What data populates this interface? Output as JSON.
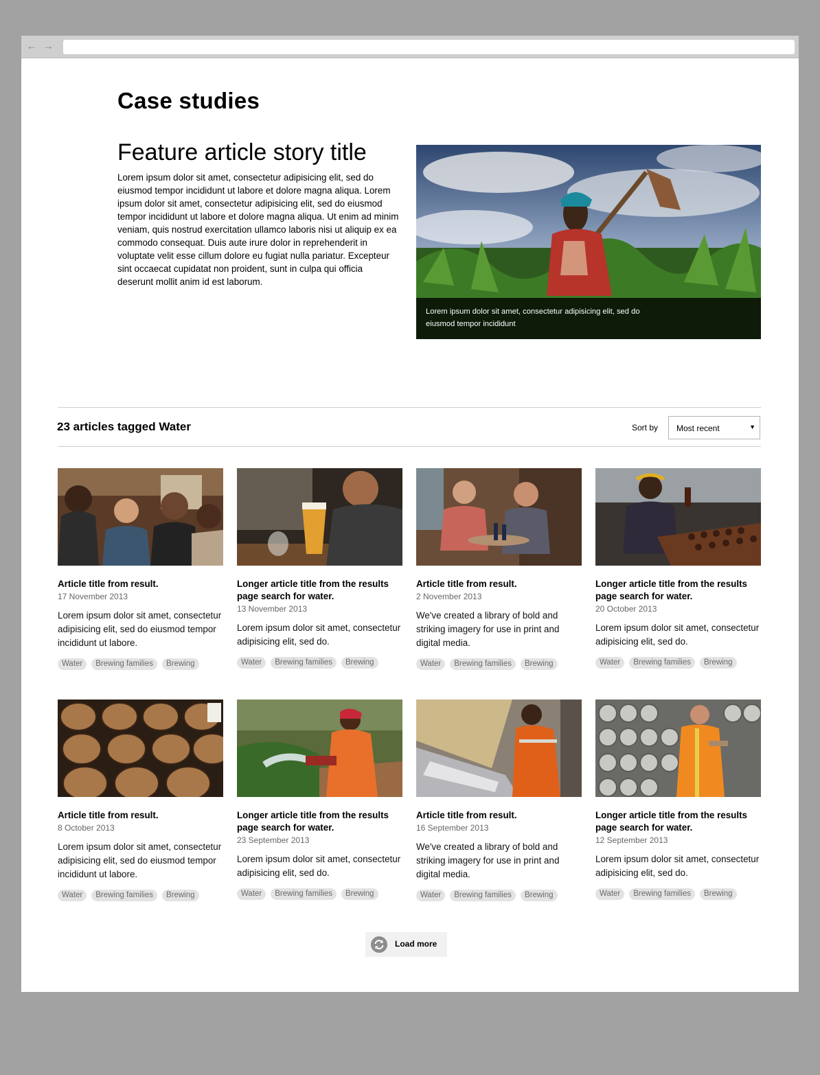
{
  "browser": {
    "back_icon": "arrow-left-icon",
    "forward_icon": "arrow-right-icon",
    "address": ""
  },
  "page": {
    "title": "Case studies"
  },
  "feature": {
    "title": "Feature article story title",
    "body": "Lorem ipsum dolor sit amet, consectetur adipisicing elit, sed do eiusmod tempor incididunt ut labore et dolore magna aliqua. Lorem ipsum dolor sit amet, consectetur adipisicing elit, sed do eiusmod tempor incididunt ut labore et dolore magna aliqua. Ut enim ad minim veniam, quis nostrud exercitation ullamco laboris nisi ut aliquip ex ea commodo consequat. Duis aute irure dolor in reprehenderit in voluptate velit esse cillum dolore eu fugiat nulla pariatur. Excepteur sint occaecat cupidatat non proident, sunt in culpa qui officia deserunt mollit anim id est laborum.",
    "image_caption": "Lorem ipsum dolor sit amet, consectetur adipisicing elit, sed do eiusmod tempor incididunt"
  },
  "results": {
    "title": "23 articles tagged Water",
    "sort_label": "Sort by",
    "sort_value": "Most recent",
    "articles": [
      {
        "title": "Article title from result.",
        "date": "17 November 2013",
        "text": "Lorem ipsum dolor sit amet, consectetur adipisicing elit, sed do eiusmod tempor incididunt ut labore.",
        "tags": [
          "Water",
          "Brewing families",
          "Brewing"
        ]
      },
      {
        "title": "Longer article title from the results page search for water.",
        "date": "13 November 2013",
        "text": "Lorem ipsum dolor sit amet, consectetur adipisicing elit, sed do.",
        "tags": [
          "Water",
          "Brewing families",
          "Brewing"
        ]
      },
      {
        "title": "Article title from result.",
        "date": "2 November 2013",
        "text": "We've created a library of bold and striking imagery for use in print and digital media.",
        "tags": [
          "Water",
          "Brewing families",
          "Brewing"
        ]
      },
      {
        "title": "Longer article title from the results page search for water.",
        "date": "20 October 2013",
        "text": "Lorem ipsum dolor sit amet, consectetur adipisicing elit, sed do.",
        "tags": [
          "Water",
          "Brewing families",
          "Brewing"
        ]
      },
      {
        "title": "Article title from result.",
        "date": "8 October 2013",
        "text": "Lorem ipsum dolor sit amet, consectetur adipisicing elit, sed do eiusmod tempor incididunt ut labore.",
        "tags": [
          "Water",
          "Brewing families",
          "Brewing"
        ]
      },
      {
        "title": "Longer article title from the results page search for water.",
        "date": "23 September 2013",
        "text": "Lorem ipsum dolor sit amet, consectetur adipisicing elit, sed do.",
        "tags": [
          "Water",
          "Brewing families",
          "Brewing"
        ]
      },
      {
        "title": "Article title from result.",
        "date": "16 September 2013",
        "text": "We've created a library of bold and striking imagery for use in print and digital media.",
        "tags": [
          "Water",
          "Brewing families",
          "Brewing"
        ]
      },
      {
        "title": "Longer article title from the results page search for water.",
        "date": "12 September 2013",
        "text": "Lorem ipsum dolor sit amet, consectetur adipisicing elit, sed do.",
        "tags": [
          "Water",
          "Brewing families",
          "Brewing"
        ]
      }
    ]
  },
  "load_more": {
    "label": "Load more",
    "icon": "refresh-icon"
  }
}
